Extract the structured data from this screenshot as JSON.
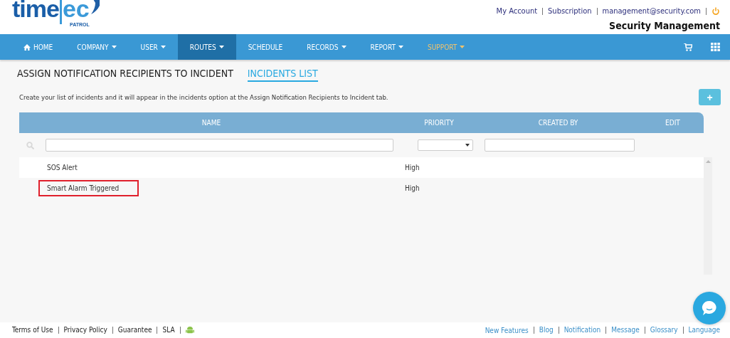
{
  "logo": {
    "word": "time",
    "tail": "ec",
    "sub": "PATROL"
  },
  "top_links": [
    "My Account",
    "Subscription",
    "management@security.com"
  ],
  "company": "Security Management",
  "nav": [
    {
      "label": "HOME",
      "kind": "home",
      "selected": false
    },
    {
      "label": "COMPANY",
      "kind": "menu",
      "selected": false
    },
    {
      "label": "USER",
      "kind": "menu",
      "selected": false
    },
    {
      "label": "ROUTES",
      "kind": "menu",
      "selected": true
    },
    {
      "label": "SCHEDULE",
      "kind": "plain",
      "selected": false
    },
    {
      "label": "RECORDS",
      "kind": "menu",
      "selected": false
    },
    {
      "label": "REPORT",
      "kind": "menu",
      "selected": false
    },
    {
      "label": "SUPPORT",
      "kind": "support",
      "selected": false
    }
  ],
  "tabs": [
    {
      "label": "ASSIGN NOTIFICATION RECIPIENTS TO INCIDENT",
      "selected": false
    },
    {
      "label": "INCIDENTS LIST",
      "selected": true
    }
  ],
  "description": "Create your list of incidents and it will appear in the incidents option at the Assign Notification Recipients to Incident tab.",
  "add_button": "+",
  "table": {
    "columns": [
      "NAME",
      "PRIORITY",
      "CREATED BY",
      "EDIT"
    ],
    "rows": [
      {
        "name": "SOS Alert",
        "priority": "High",
        "highlighted": false
      },
      {
        "name": "Smart Alarm Triggered",
        "priority": "High",
        "highlighted": true
      }
    ]
  },
  "footer_left": [
    "Terms of Use",
    "Privacy Policy",
    "Guarantee",
    "SLA"
  ],
  "footer_right": [
    "New Features",
    "Blog",
    "Notification",
    "Message",
    "Glossary",
    "Language"
  ]
}
